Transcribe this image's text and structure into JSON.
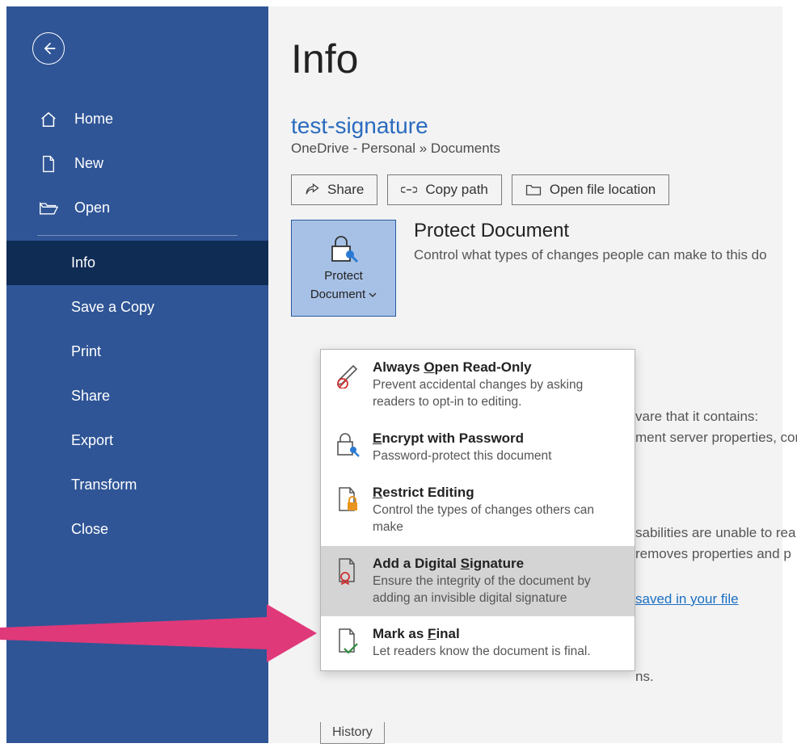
{
  "sidebar": {
    "items": [
      {
        "label": "Home"
      },
      {
        "label": "New"
      },
      {
        "label": "Open"
      },
      {
        "label": "Info"
      },
      {
        "label": "Save a Copy"
      },
      {
        "label": "Print"
      },
      {
        "label": "Share"
      },
      {
        "label": "Export"
      },
      {
        "label": "Transform"
      },
      {
        "label": "Close"
      }
    ]
  },
  "main": {
    "page_title": "Info",
    "doc_title": "test-signature",
    "doc_path": "OneDrive - Personal » Documents",
    "actions": {
      "share": "Share",
      "copy": "Copy path",
      "open_loc": "Open file location"
    },
    "protect": {
      "btn_line1": "Protect",
      "btn_line2": "Document",
      "heading": "Protect Document",
      "desc": "Control what types of changes people can make to this do"
    },
    "bg": {
      "f1": "vare that it contains:",
      "f2": "ment server properties, cor",
      "f3": "sabilities are unable to rea",
      "f4": "removes properties and p",
      "f5": "saved in your file",
      "f6": "ns.",
      "history": "History"
    },
    "menu": [
      {
        "title_pre": "Always ",
        "title_ul": "O",
        "title_post": "pen Read-Only",
        "desc": "Prevent accidental changes by asking readers to opt-in to editing."
      },
      {
        "title_pre": "",
        "title_ul": "E",
        "title_post": "ncrypt with Password",
        "desc": "Password-protect this document"
      },
      {
        "title_pre": "",
        "title_ul": "R",
        "title_post": "estrict Editing",
        "desc": "Control the types of changes others can make"
      },
      {
        "title_pre": "Add a Digital ",
        "title_ul": "S",
        "title_post": "ignature",
        "desc": "Ensure the integrity of the document by adding an invisible digital signature"
      },
      {
        "title_pre": "Mark as ",
        "title_ul": "F",
        "title_post": "inal",
        "desc": "Let readers know the document is final."
      }
    ]
  }
}
